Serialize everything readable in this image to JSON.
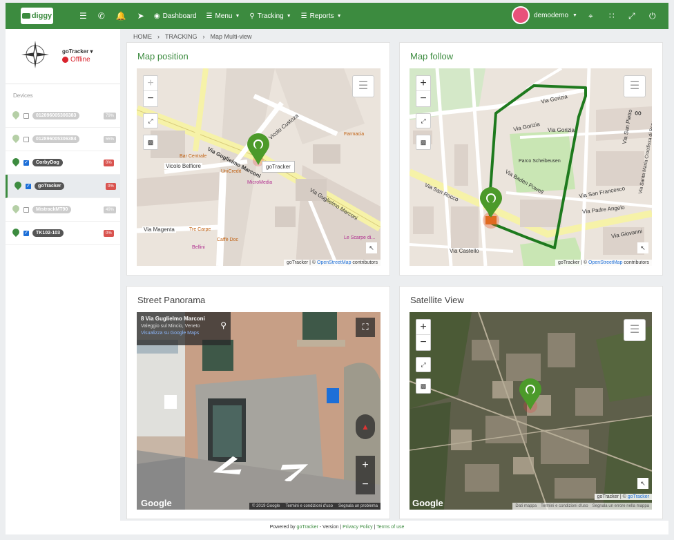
{
  "topbar": {
    "logo": "diggy",
    "nav": [
      {
        "label": "Dashboard",
        "icon": "dashboard-icon"
      },
      {
        "label": "Menu",
        "icon": "menu-icon"
      },
      {
        "label": "Tracking",
        "icon": "map-marker-icon"
      },
      {
        "label": "Reports",
        "icon": "reports-icon"
      }
    ],
    "username": "demodemo"
  },
  "device": {
    "name": "goTracker",
    "status": "Offline"
  },
  "sidebar": {
    "title": "Devices",
    "devices": [
      {
        "label": "012896005306383",
        "battery": "79%",
        "checked": false,
        "dim": true
      },
      {
        "label": "012896005306384",
        "battery": "55%",
        "checked": false,
        "dim": true
      },
      {
        "label": "CorbyDog",
        "battery": "0%",
        "checked": true,
        "dim": false
      },
      {
        "label": "goTracker",
        "battery": "0%",
        "checked": true,
        "dim": false,
        "selected": true
      },
      {
        "label": "MistrackMT90",
        "battery": "49%",
        "checked": false,
        "dim": true
      },
      {
        "label": "TK102-103",
        "battery": "0%",
        "checked": true,
        "dim": false
      }
    ]
  },
  "breadcrumb": {
    "home": "HOME",
    "tracking": "TRACKING",
    "current": "Map Multi-view"
  },
  "cards": {
    "map_position": {
      "title": "Map position",
      "marker_label": "goTracker",
      "attrib_prefix": "goTracker | ©",
      "attrib_link": "OpenStreetMap",
      "attrib_suffix": "contributors",
      "streets": [
        "Via Guglielmo Marconi",
        "Vicolo Custoza",
        "Vicolo Belfiore",
        "Via Magenta",
        "Via Guglielmo Marconi"
      ],
      "pois": [
        "Bar Centrale",
        "UniCredit",
        "MicroMedia",
        "Farmacia",
        "Tre Carpe",
        "Caffè Doc",
        "Bellini",
        "Le Scarpe di..."
      ]
    },
    "map_follow": {
      "title": "Map follow",
      "attrib_prefix": "goTracker | ©",
      "attrib_link": "OpenStreetMap",
      "attrib_suffix": "contributors",
      "streets": [
        "Via Gorizia",
        "Via Gorizia",
        "Via Gorizia",
        "Parco Scheibeusen",
        "Via Baden Powell",
        "Via San Rocco",
        "Via San Francesco",
        "Via Padre Angelo",
        "Via Giovanni",
        "Via Castello",
        "Via San Pietro",
        "Via Santa Maria Crocifissa di Rosa"
      ]
    },
    "street_panorama": {
      "title": "Street Panorama",
      "address": "8 Via Guglielmo Marconi",
      "locality": "Valeggio sul Mincio, Veneto",
      "link": "Visualizza su Google Maps",
      "brand": "Google",
      "footer": [
        "© 2019 Google",
        "Termini e condizioni d'uso",
        "Segnala un problema"
      ]
    },
    "satellite": {
      "title": "Satellite View",
      "attrib_prefix": "goTracker | ©",
      "attrib_link": "goTracker",
      "brand": "Google",
      "footer": [
        "Dati mappa",
        "Termini e condizioni d'uso",
        "Segnala un errore nella mappa"
      ]
    }
  },
  "footer": {
    "powered": "Powered by",
    "brand": "goTracker",
    "version": "- Version",
    "privacy": "Privacy Policy",
    "terms": "Terms of use"
  },
  "colors": {
    "brand": "#3c8b3f",
    "offline": "#d9232d",
    "route": "#1e7a1e"
  }
}
